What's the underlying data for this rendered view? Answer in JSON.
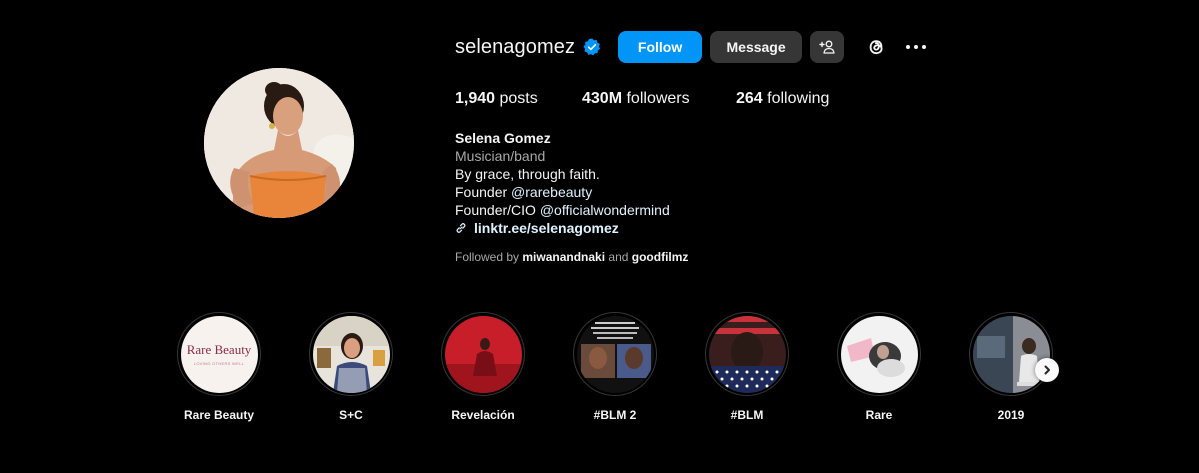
{
  "profile": {
    "username": "selenagomez",
    "follow_label": "Follow",
    "message_label": "Message",
    "accent_color": "#0095f6",
    "verified_icon": "verified-badge-icon",
    "avatar_desc": "profile-photo"
  },
  "stats": {
    "posts_count": "1,940",
    "posts_label": "posts",
    "followers_count": "430M",
    "followers_label": "followers",
    "following_count": "264",
    "following_label": "following"
  },
  "bio": {
    "full_name": "Selena Gomez",
    "category": "Musician/band",
    "line1": "By grace, through faith.",
    "line2_prefix": "Founder ",
    "line2_mention": "@rarebeauty",
    "line3_prefix": "Founder/CIO ",
    "line3_mention": "@officialwondermind",
    "link": "linktr.ee/selenagomez"
  },
  "followed_by": {
    "prefix": "Followed by ",
    "user1": "miwanandnaki",
    "conjunction": " and ",
    "user2": "goodfilmz"
  },
  "highlights": [
    {
      "label": "Rare Beauty",
      "cover_text": "Rare Beauty",
      "cover_subtext": "LOVING OTHERS WELL"
    },
    {
      "label": "S+C"
    },
    {
      "label": "Revelación"
    },
    {
      "label": "#BLM 2"
    },
    {
      "label": "#BLM"
    },
    {
      "label": "Rare"
    },
    {
      "label": "2019"
    }
  ]
}
